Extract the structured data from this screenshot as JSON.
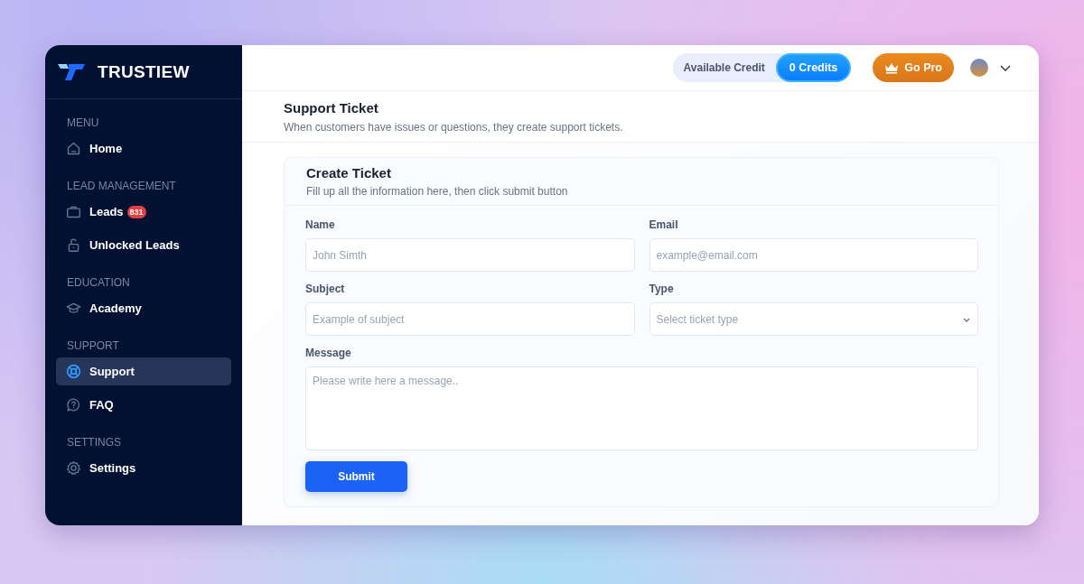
{
  "brand": {
    "name": "TRUSTIEW"
  },
  "sidebar": {
    "groups": [
      {
        "heading": "MENU",
        "items": [
          {
            "label": "Home",
            "kind": "home",
            "selected": false
          }
        ]
      },
      {
        "heading": "LEAD MANAGEMENT",
        "items": [
          {
            "label": "Leads",
            "kind": "briefcase",
            "selected": false,
            "badge": "831"
          },
          {
            "label": "Unlocked Leads",
            "kind": "lock",
            "selected": false
          }
        ]
      },
      {
        "heading": "EDUCATION",
        "items": [
          {
            "label": "Academy",
            "kind": "academy",
            "selected": false
          }
        ]
      },
      {
        "heading": "SUPPORT",
        "items": [
          {
            "label": "Support",
            "kind": "support",
            "selected": true
          },
          {
            "label": "FAQ",
            "kind": "faq",
            "selected": false
          }
        ]
      },
      {
        "heading": "SETTINGS",
        "items": [
          {
            "label": "Settings",
            "kind": "settings",
            "selected": false
          }
        ]
      }
    ]
  },
  "topbar": {
    "credit_label": "Available Credit",
    "credits": "0 Credits",
    "upgrade": "Go Pro"
  },
  "page": {
    "title": "Support Ticket",
    "subtitle": "When customers have issues or questions, they create support tickets."
  },
  "card": {
    "title": "Create Ticket",
    "subtitle": "Fill up all the information here, then click submit button",
    "fields": [
      {
        "label": "Name",
        "kind": "text",
        "placeholder": "John Simth"
      },
      {
        "label": "Email",
        "kind": "text",
        "placeholder": "example@email.com"
      },
      {
        "label": "Subject",
        "kind": "text",
        "placeholder": "Example of subject"
      },
      {
        "label": "Type",
        "kind": "select",
        "placeholder": "Select ticket type"
      },
      {
        "label": "Message",
        "kind": "textarea",
        "placeholder": "Please write here a message.."
      }
    ],
    "submit": "Submit"
  }
}
